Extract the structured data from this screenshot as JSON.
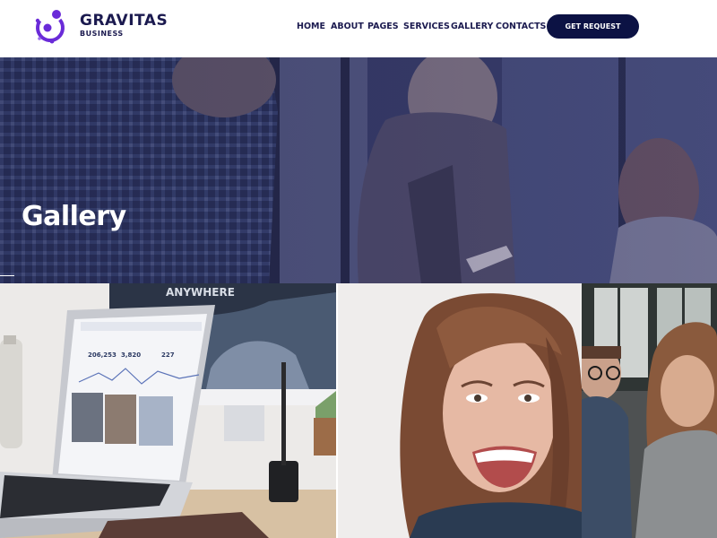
{
  "brand": {
    "name": "GRAVITAS",
    "tagline": "BUSINESS"
  },
  "nav": {
    "items": [
      {
        "label": "HOME"
      },
      {
        "label": "ABOUT"
      },
      {
        "label": "PAGES"
      },
      {
        "label": "SERVICES"
      },
      {
        "label": "GALLERY"
      },
      {
        "label": "CONTACTS"
      }
    ],
    "cta_label": "GET REQUEST"
  },
  "hero": {
    "title": "Gallery"
  },
  "gallery": {
    "tiles": [
      {
        "subject": "laptop-on-desk",
        "monitor_text": "ANYWHERE",
        "stats": [
          "206,253",
          "3,820",
          "227"
        ]
      },
      {
        "subject": "smiling-woman"
      },
      {
        "subject": "coworkers-in-office"
      }
    ]
  },
  "colors": {
    "brand_navy": "#1b1a4f",
    "button_navy": "#0c1244",
    "logo_purple": "#6a2bd8",
    "hero_overlay": "#2b2d5a"
  },
  "icons": {
    "logo": "gravitas-logo-icon"
  }
}
